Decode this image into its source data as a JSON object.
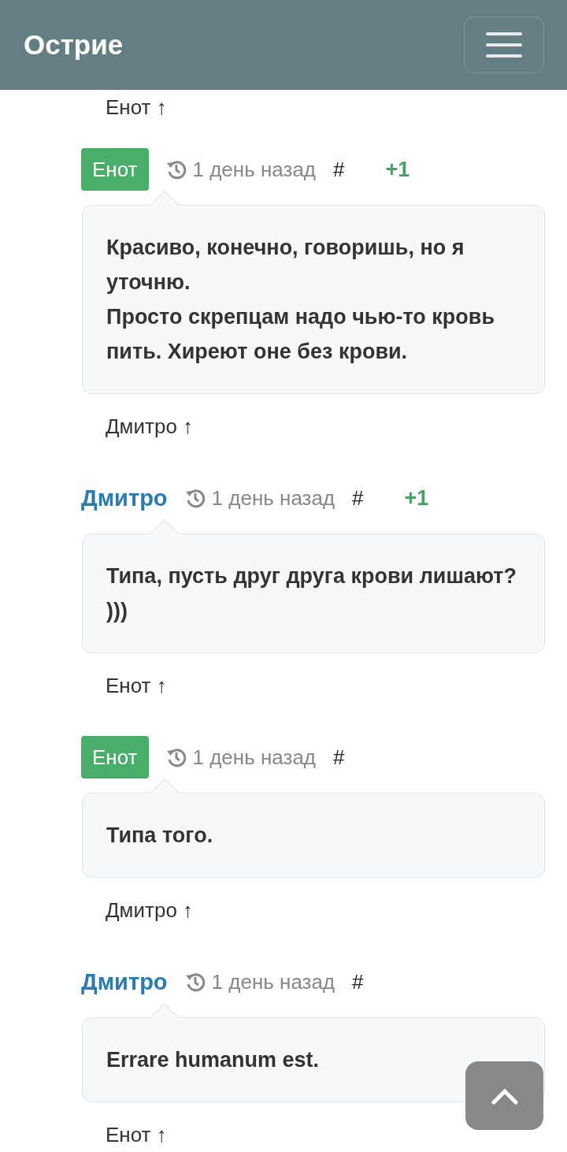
{
  "header": {
    "title": "Острие"
  },
  "top_reply": "Енот ↑",
  "comments": [
    {
      "author": {
        "name": "Енот",
        "kind": "badge"
      },
      "time": "1 день назад",
      "anchor": "#",
      "score": "+1",
      "text": "Красиво, конечно, говоришь, но я уточню.\nПросто скрепцам надо чью-то кровь пить. Хиреют оне без крови.",
      "reply": "Дмитро ↑"
    },
    {
      "author": {
        "name": "Дмитро",
        "kind": "link"
      },
      "time": "1 день назад",
      "anchor": "#",
      "score": "+1",
      "text": "Типа, пусть друг друга крови лишают? )))",
      "reply": "Енот ↑"
    },
    {
      "author": {
        "name": "Енот",
        "kind": "badge"
      },
      "time": "1 день назад",
      "anchor": "#",
      "text": "Типа того.",
      "reply": "Дмитро ↑"
    },
    {
      "author": {
        "name": "Дмитро",
        "kind": "link"
      },
      "time": "1 день назад",
      "anchor": "#",
      "text": "Errare humanum est.",
      "reply": "Енот ↑"
    }
  ]
}
